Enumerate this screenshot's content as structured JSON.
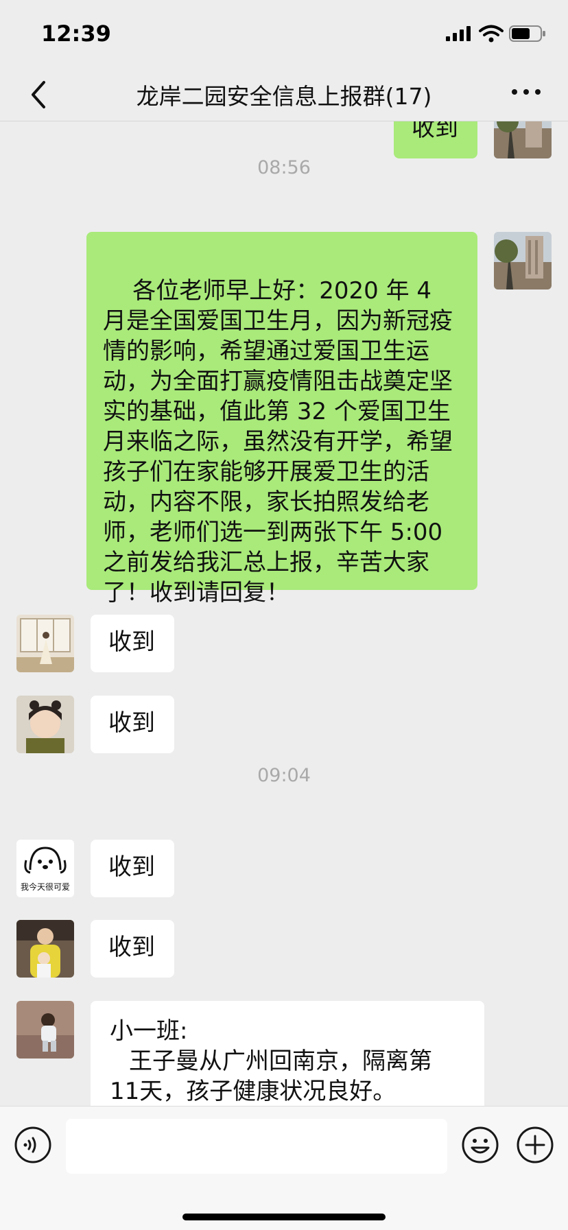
{
  "status": {
    "time": "12:39"
  },
  "nav": {
    "title": "龙岸二园安全信息上报群(17)"
  },
  "icons": {
    "back": "chevron-left-icon",
    "more": "more-dots-icon",
    "voice": "voice-icon",
    "emoji": "emoji-icon",
    "plus": "plus-icon"
  },
  "colors": {
    "mine_bubble": "#a9ea7a",
    "their_bubble": "#ffffff",
    "background": "#ededed"
  },
  "messages": {
    "top_partial": "收到",
    "ts1": "08:56",
    "notice": "各位老师早上好：2020 年 4 月是全国爱国卫生月，因为新冠疫情的影响，希望通过爱国卫生运动，为全面打赢疫情阻击战奠定坚实的基础，值此第 32 个爱国卫生月来临之际，虽然没有开学，希望孩子们在家能够开展爱卫生的活动，内容不限，家长拍照发给老师，老师们选一到两张下午 5:00 之前发给我汇总上报，辛苦大家了！收到请回复！",
    "r1": "收到",
    "r2": "收到",
    "ts2": "09:04",
    "r3": "收到",
    "r4": "收到",
    "report_line1": "小一班:",
    "report_line2": "王子曼从广州回南京，隔离第",
    "report_line3": "11天，孩子健康状况良好。"
  },
  "avatars": {
    "avatar3_caption": "我今天很可爱"
  }
}
